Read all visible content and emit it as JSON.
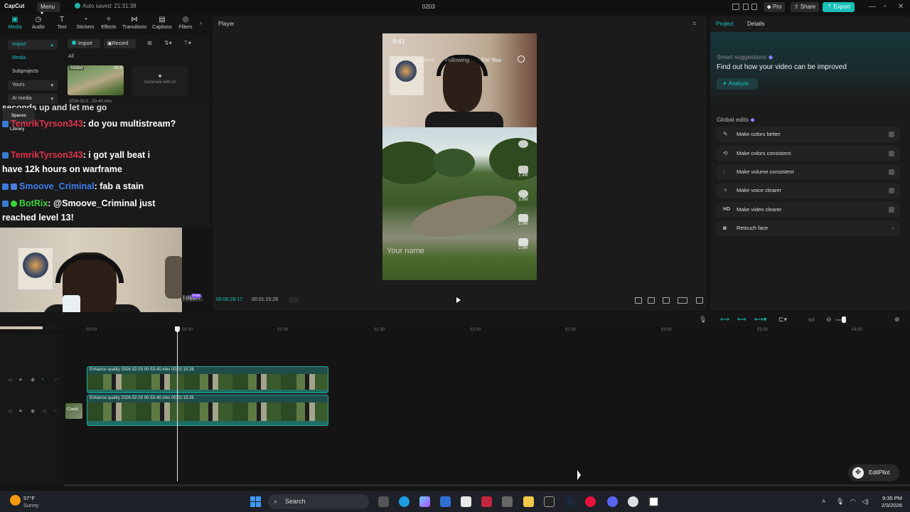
{
  "titlebar": {
    "logo": "CapCut",
    "menu": "Menu",
    "autosave": "Auto saved: 21:31:38",
    "project_name": "0203",
    "pro": "Pro",
    "share": "Share",
    "export": "Export"
  },
  "toolbar": {
    "tools": [
      {
        "label": "Media",
        "icon": "media-icon"
      },
      {
        "label": "Audio",
        "icon": "audio-icon"
      },
      {
        "label": "Text",
        "icon": "text-icon"
      },
      {
        "label": "Stickers",
        "icon": "stickers-icon"
      },
      {
        "label": "Effects",
        "icon": "effects-icon"
      },
      {
        "label": "Transitions",
        "icon": "transitions-icon"
      },
      {
        "label": "Captions",
        "icon": "captions-icon"
      },
      {
        "label": "Filters",
        "icon": "filters-icon"
      }
    ]
  },
  "sidebar": {
    "items": [
      "Import",
      "Media",
      "Subprojects",
      "Yours",
      "AI media",
      "Spaces",
      "Library"
    ]
  },
  "media": {
    "import": "Import",
    "record": "Record",
    "all": "All",
    "thumb_tag": "Added",
    "thumb_duration": "02:0",
    "thumb_name": "2026-02-0...53-40.mkv",
    "generate_ai": "Generate with AI"
  },
  "chat": {
    "partial": "seconds up and let me go",
    "lines": [
      {
        "user": "TemrikTyrson343",
        "text": ": do you multistream?"
      },
      {
        "user": "TemrikTyrson343",
        "text": ": i got yall beat i have 12k hours on warframe"
      },
      {
        "user": "Smoove_Criminal",
        "text": ": fab a stain"
      },
      {
        "user": "BotRix",
        "text": ": @Smoove_Criminal just reached level 13!"
      }
    ]
  },
  "webcam": {
    "clipper": "l clipper",
    "free": "Free"
  },
  "player": {
    "title": "Player",
    "time_current": "00:00:28:17",
    "time_total": "00:01:15:26",
    "phone": {
      "clock": "9:41",
      "nav": [
        "Explore",
        "Following",
        "For You"
      ],
      "counts": [
        "2.4M",
        "2.8M",
        "2.8M",
        "2.8M"
      ],
      "yourname": "Your name"
    }
  },
  "rightpanel": {
    "tab_project": "Project",
    "tab_details": "Details",
    "smart_label": "Smart suggestions",
    "smart_title": "Find out how your video can be improved",
    "analyze": "Analyze",
    "global_label": "Global edits",
    "edits": [
      {
        "icon": "wand-icon",
        "label": "Make colors better"
      },
      {
        "icon": "palette-icon",
        "label": "Make colors consistent"
      },
      {
        "icon": "volume-icon",
        "label": "Make volume consistent"
      },
      {
        "icon": "voice-icon",
        "label": "Make voice clearer"
      },
      {
        "icon": "hd-icon",
        "label": "Make video clearer",
        "glyph": "HD"
      },
      {
        "icon": "face-icon",
        "label": "Retouch face"
      }
    ]
  },
  "timeline": {
    "ruler": [
      "00:00",
      "00:30",
      "01:00",
      "01:30",
      "02:00",
      "02:30",
      "03:00",
      "03:30",
      "04:00"
    ],
    "clips": [
      {
        "label": "Enhance quality  2026-02-03 00-53-40.mkv   00:01:15:26"
      },
      {
        "label": "Enhance quality  2026-02-03 00-53-40.mkv   00:01:15:26"
      }
    ],
    "cover": "Cover"
  },
  "editpilot": "EditPilot",
  "taskbar": {
    "temp": "57°F",
    "cond": "Sunny",
    "search": "Search",
    "time": "9:35 PM",
    "date": "2/3/2026"
  },
  "colors": {
    "accent": "#19c4bd",
    "export": "#18c0b8",
    "chat_red": "#e0334b",
    "chat_blue": "#3d7ff0",
    "chat_green": "#3bd43b"
  }
}
